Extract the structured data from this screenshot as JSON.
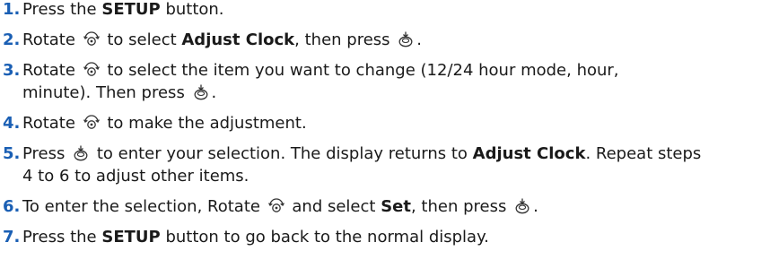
{
  "steps": [
    {
      "num": "1.",
      "parts": [
        {
          "t": "text",
          "v": "Press the "
        },
        {
          "t": "bold",
          "v": "SETUP"
        },
        {
          "t": "text",
          "v": " button."
        }
      ]
    },
    {
      "num": "2.",
      "parts": [
        {
          "t": "text",
          "v": "Rotate "
        },
        {
          "t": "icon",
          "v": "rotate-knob-icon"
        },
        {
          "t": "text",
          "v": " to select "
        },
        {
          "t": "bold",
          "v": "Adjust Clock"
        },
        {
          "t": "text",
          "v": ", then press "
        },
        {
          "t": "icon",
          "v": "press-knob-icon"
        },
        {
          "t": "text",
          "v": "."
        }
      ]
    },
    {
      "num": "3.",
      "parts": [
        {
          "t": "text",
          "v": "Rotate "
        },
        {
          "t": "icon",
          "v": "rotate-knob-icon"
        },
        {
          "t": "text",
          "v": " to select the item you want to change (12/24 hour mode, hour,"
        },
        {
          "t": "br"
        },
        {
          "t": "text",
          "v": "minute). Then press "
        },
        {
          "t": "icon",
          "v": "press-knob-icon"
        },
        {
          "t": "text",
          "v": "."
        }
      ]
    },
    {
      "num": "4.",
      "parts": [
        {
          "t": "text",
          "v": "Rotate "
        },
        {
          "t": "icon",
          "v": "rotate-knob-icon"
        },
        {
          "t": "text",
          "v": " to make the adjustment."
        }
      ]
    },
    {
      "num": "5.",
      "parts": [
        {
          "t": "text",
          "v": "Press "
        },
        {
          "t": "icon",
          "v": "press-knob-icon"
        },
        {
          "t": "text",
          "v": " to enter your selection. The display returns to "
        },
        {
          "t": "bold",
          "v": "Adjust Clock"
        },
        {
          "t": "text",
          "v": ". Repeat steps"
        },
        {
          "t": "br"
        },
        {
          "t": "text",
          "v": "4 to 6 to adjust other items."
        }
      ]
    },
    {
      "num": "6.",
      "parts": [
        {
          "t": "text",
          "v": "To enter the selection, Rotate "
        },
        {
          "t": "icon",
          "v": "rotate-knob-icon"
        },
        {
          "t": "text",
          "v": " and select "
        },
        {
          "t": "bold",
          "v": "Set"
        },
        {
          "t": "text",
          "v": ", then press "
        },
        {
          "t": "icon",
          "v": "press-knob-icon"
        },
        {
          "t": "text",
          "v": "."
        }
      ]
    },
    {
      "num": "7.",
      "parts": [
        {
          "t": "text",
          "v": "Press the "
        },
        {
          "t": "bold",
          "v": "SETUP"
        },
        {
          "t": "text",
          "v": " button to go back to the normal display."
        }
      ]
    }
  ]
}
